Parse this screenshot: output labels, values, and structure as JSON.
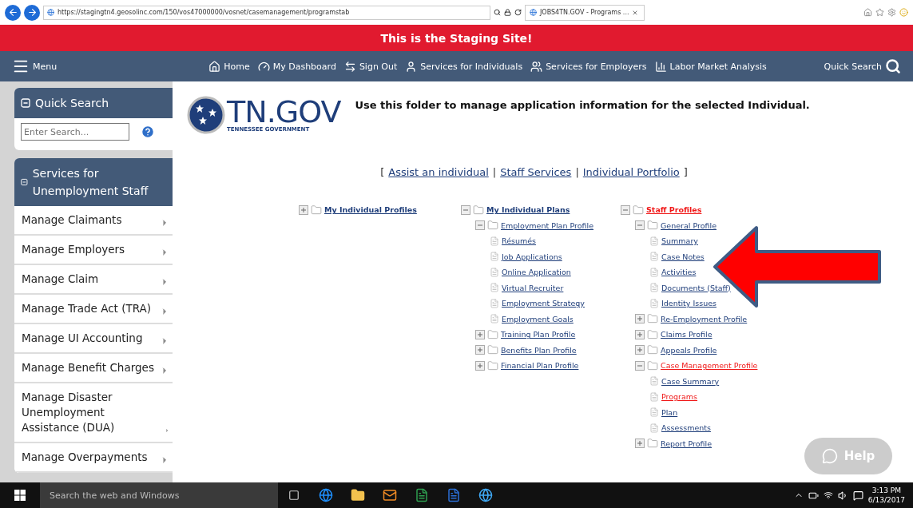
{
  "browser": {
    "address": "https://stagingtn4.geosolinc.com/150/vos47000000/vosnet/casemanagement/programstab",
    "tab_title": "JOBS4TN.GOV - Programs ..."
  },
  "banner": "This is the Staging Site!",
  "nav": {
    "menu": "Menu",
    "items": [
      {
        "kind": "home",
        "label": "Home"
      },
      {
        "kind": "dashboard",
        "label": "My Dashboard"
      },
      {
        "kind": "signout",
        "label": "Sign Out"
      },
      {
        "kind": "individuals",
        "label": "Services for Individuals"
      },
      {
        "kind": "employers",
        "label": "Services for Employers"
      },
      {
        "kind": "analysis",
        "label": "Labor Market Analysis"
      }
    ],
    "quick_search": "Quick Search"
  },
  "sidebar": {
    "quick_search": {
      "title": "Quick Search",
      "placeholder": "Enter Search..."
    },
    "services_title": "Services for Unemployment Staff",
    "items": [
      "Manage Claimants",
      "Manage Employers",
      "Manage Claim",
      "Manage Trade Act (TRA)",
      "Manage UI Accounting",
      "Manage Benefit Charges",
      "Manage Disaster Unemployment Assistance (DUA)",
      "Manage Overpayments"
    ]
  },
  "logo": {
    "name": "TN.GOV",
    "tagline": "TENNESSEE GOVERNMENT"
  },
  "heading": "Use this folder to manage application information for the selected Individual.",
  "links": {
    "open": "[",
    "close": "]",
    "items": [
      "Assist an individual",
      "Staff Services",
      "Individual Portfolio"
    ],
    "separator": "|"
  },
  "trees": [
    [
      {
        "label": "My Individual Profiles",
        "kind": "folder",
        "expanded": false,
        "selected": false
      }
    ],
    [
      {
        "label": "My Individual Plans",
        "kind": "folder",
        "expanded": true,
        "selected": false,
        "children": [
          {
            "label": "Employment Plan Profile",
            "kind": "folder",
            "expanded": true,
            "selected": false,
            "children": [
              {
                "label": "Résumés",
                "kind": "page",
                "selected": false
              },
              {
                "label": "Job Applications",
                "kind": "page",
                "selected": false
              },
              {
                "label": "Online Application",
                "kind": "page",
                "selected": false
              },
              {
                "label": "Virtual Recruiter",
                "kind": "page",
                "selected": false
              },
              {
                "label": "Employment Strategy",
                "kind": "page",
                "selected": false
              },
              {
                "label": "Employment Goals",
                "kind": "page",
                "selected": false
              }
            ]
          },
          {
            "label": "Training Plan Profile",
            "kind": "folder",
            "expanded": false,
            "selected": false
          },
          {
            "label": "Benefits Plan Profile",
            "kind": "folder",
            "expanded": false,
            "selected": false
          },
          {
            "label": "Financial Plan Profile",
            "kind": "folder",
            "expanded": false,
            "selected": false
          }
        ]
      }
    ],
    [
      {
        "label": "Staff Profiles",
        "kind": "folder",
        "expanded": true,
        "selected": true,
        "children": [
          {
            "label": "General Profile",
            "kind": "folder",
            "expanded": true,
            "selected": false,
            "children": [
              {
                "label": "Summary",
                "kind": "page",
                "selected": false
              },
              {
                "label": "Case Notes",
                "kind": "page",
                "selected": false
              },
              {
                "label": "Activities",
                "kind": "page",
                "selected": false
              },
              {
                "label": "Documents (Staff)",
                "kind": "page",
                "selected": false
              },
              {
                "label": "Identity Issues",
                "kind": "page",
                "selected": false
              }
            ]
          },
          {
            "label": "Re-Employment Profile",
            "kind": "folder",
            "expanded": false,
            "selected": false
          },
          {
            "label": "Claims Profile",
            "kind": "folder",
            "expanded": false,
            "selected": false
          },
          {
            "label": "Appeals Profile",
            "kind": "folder",
            "expanded": false,
            "selected": false
          },
          {
            "label": "Case Management Profile",
            "kind": "folder",
            "expanded": true,
            "selected": true,
            "children": [
              {
                "label": "Case Summary",
                "kind": "page",
                "selected": false
              },
              {
                "label": "Programs",
                "kind": "page",
                "selected": true
              },
              {
                "label": "Plan",
                "kind": "page",
                "selected": false
              },
              {
                "label": "Assessments",
                "kind": "page",
                "selected": false
              }
            ]
          },
          {
            "label": "Report Profile",
            "kind": "folder",
            "expanded": false,
            "selected": false
          }
        ]
      }
    ]
  ],
  "help": "Help",
  "taskbar": {
    "search": "Search the web and Windows",
    "time": "3:13 PM",
    "date": "6/13/2017"
  }
}
